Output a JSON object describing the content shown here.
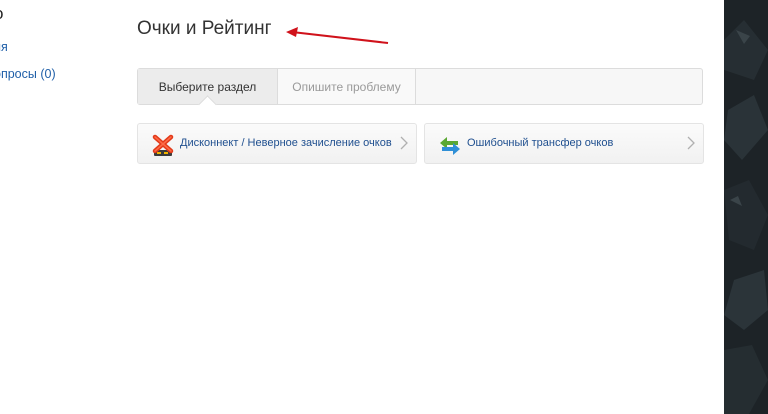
{
  "sidebar": {
    "heading_fragment": "о",
    "link1": "ия",
    "link2": "опросы (0)"
  },
  "main": {
    "title": "Очки и Рейтинг",
    "tabs": [
      {
        "label": "Выберите раздел",
        "active": true
      },
      {
        "label": "Опишите проблему",
        "active": false
      }
    ],
    "cards": [
      {
        "label": "Дисконнект / Неверное зачисление очков",
        "icon": "disconnect-red-x-icon"
      },
      {
        "label": "Ошибочный трансфер очков",
        "icon": "transfer-arrows-icon"
      }
    ]
  },
  "colors": {
    "link": "#1f5fa8",
    "annotation_arrow": "#d0121b",
    "tab_active_bg": "#ececec",
    "right_strip": "#1d2327"
  }
}
